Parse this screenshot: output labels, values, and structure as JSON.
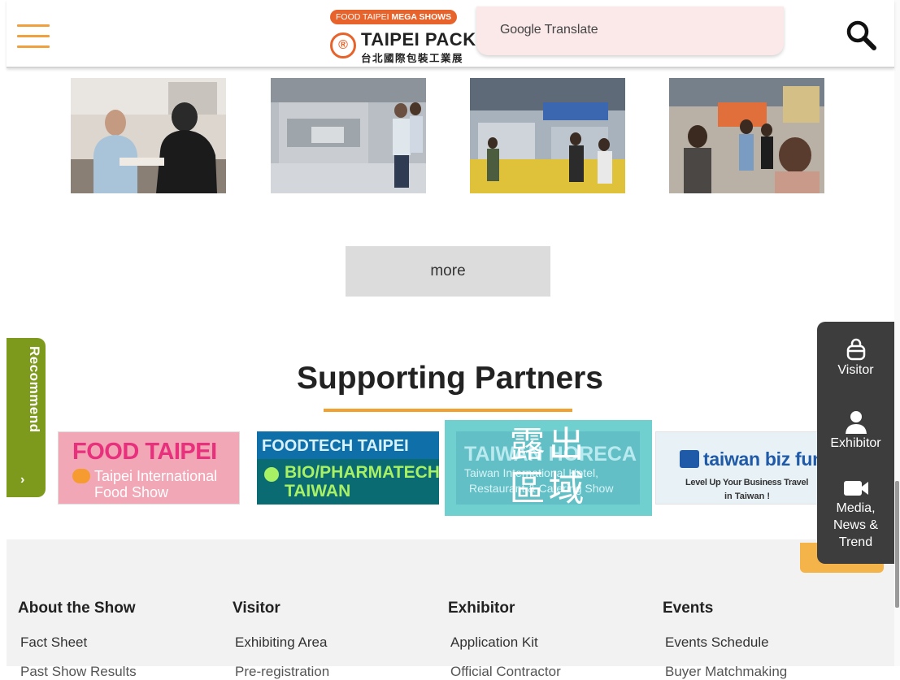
{
  "header": {
    "logo_badge_light": "FOOD TAIPEI",
    "logo_badge_bold": "MEGA SHOWS",
    "logo_name": "TAIPEI PACK",
    "logo_name_cn": "台北國際包裝工業展",
    "translate_label_google": "Google",
    "translate_label_text": "Translate",
    "menu_icon": "hamburger-menu-icon",
    "search_icon": "search-icon"
  },
  "gallery": {
    "photos": [
      "photo-1",
      "photo-2",
      "photo-3",
      "photo-4"
    ]
  },
  "more_button": "more",
  "recommend": {
    "label": "Recommend",
    "arrow": "›"
  },
  "partners": {
    "title": "Supporting Partners",
    "food_taipei": {
      "title": "FOOD TAIPEI",
      "sub1": "Taipei International",
      "sub2": "Food Show"
    },
    "foodtech": {
      "line1": "FOODTECH TAIPEI",
      "line2": "BIO/PHARMATECH",
      "line3": "TAIWAN"
    },
    "horeca": {
      "name": "TAIWAN HORECA",
      "sub1": "Taiwan International Hotel,",
      "sub2": "Restaurant & Catering Show",
      "overlay_line1": "露出",
      "overlay_line2": "區域"
    },
    "biz_fun": {
      "name": "taiwan biz fun",
      "sub1": "Level Up Your Business Travel",
      "sub2": "in Taiwan !"
    }
  },
  "side_panel": {
    "visitor": "Visitor",
    "exhibitor": "Exhibitor",
    "media_line1": "Media,",
    "media_line2": "News &",
    "media_line3": "Trend"
  },
  "footer": {
    "columns": [
      {
        "heading": "About the Show",
        "links": [
          "Fact Sheet",
          "Past Show Results"
        ]
      },
      {
        "heading": "Visitor",
        "links": [
          "Exhibiting Area",
          "Pre-registration"
        ]
      },
      {
        "heading": "Exhibitor",
        "links": [
          "Application Kit",
          "Official Contractor"
        ]
      },
      {
        "heading": "Events",
        "links": [
          "Events Schedule",
          "Buyer Matchmaking"
        ]
      }
    ]
  },
  "colors": {
    "accent_orange": "#f2a02e",
    "recommend_green": "#7e9a1c",
    "side_panel_dark": "#3d3d3d"
  }
}
